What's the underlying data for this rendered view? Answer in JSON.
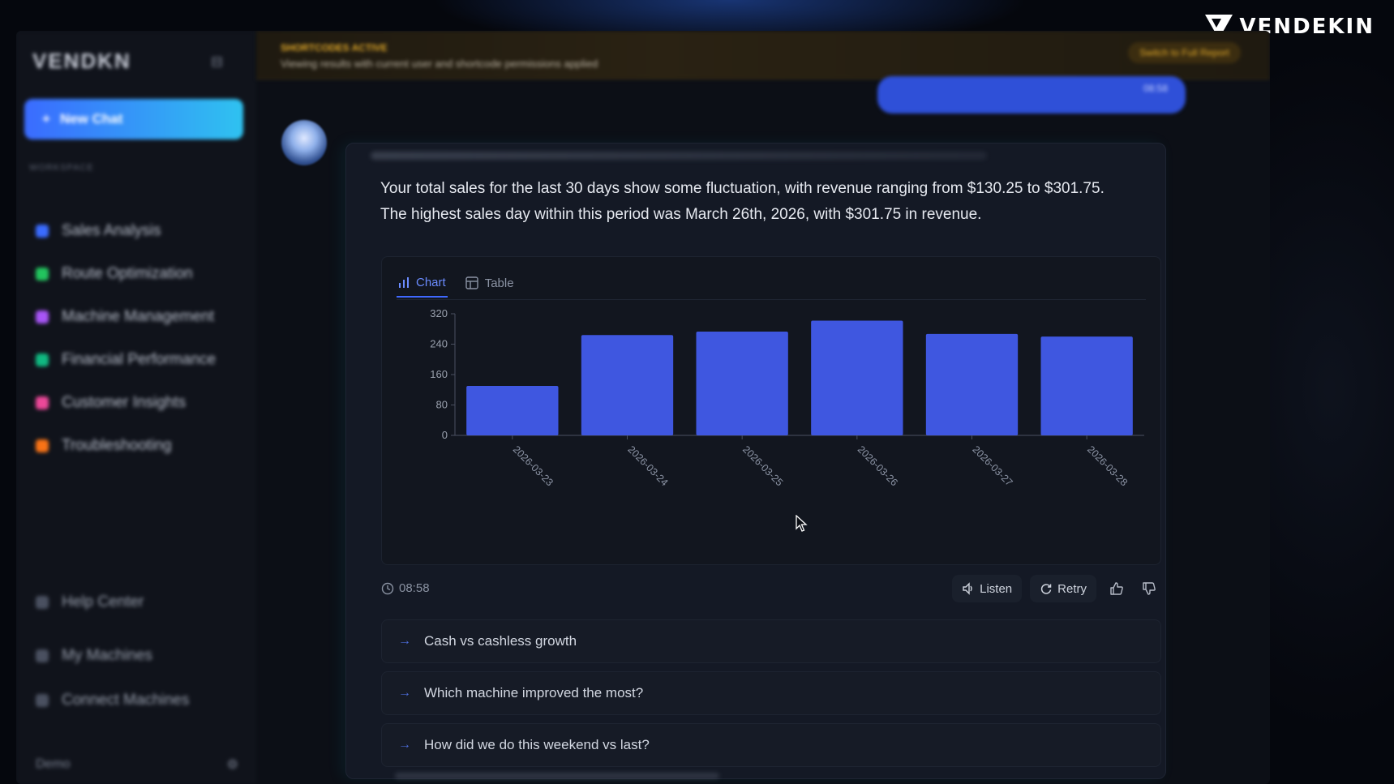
{
  "brand": {
    "name": "VENDEKIN"
  },
  "sidebar": {
    "logo": "VENDKN",
    "new_chat": "New Chat",
    "section_label": "WORKSPACE",
    "items": [
      {
        "label": "Sales Analysis",
        "color": "#3a6bff"
      },
      {
        "label": "Route Optimization",
        "color": "#22c55e"
      },
      {
        "label": "Machine Management",
        "color": "#a855f7"
      },
      {
        "label": "Financial Performance",
        "color": "#10b981"
      },
      {
        "label": "Customer Insights",
        "color": "#ec4899"
      },
      {
        "label": "Troubleshooting",
        "color": "#f97316"
      }
    ],
    "footer": [
      {
        "label": "Help Center"
      },
      {
        "label": "My Machines"
      },
      {
        "label": "Connect Machines"
      }
    ],
    "user": "Demo"
  },
  "banner": {
    "title": "SHORTCODES ACTIVE",
    "text": "Viewing results with current user and shortcode permissions applied",
    "button": "Switch to Full Report"
  },
  "user_message": {
    "time": "08:58"
  },
  "assistant": {
    "message_line1": "Your total sales for the last 30 days show some fluctuation, with revenue ranging from $130.25 to $301.75.",
    "message_line2": "The highest sales day within this period was March 26th, 2026, with $301.75 in revenue.",
    "tabs": {
      "chart": "Chart",
      "table": "Table"
    },
    "timestamp": "08:58",
    "actions": {
      "listen": "Listen",
      "retry": "Retry"
    },
    "suggestions": [
      "Cash vs cashless growth",
      "Which machine improved the most?",
      "How did we do this weekend vs last?"
    ]
  },
  "chart_data": {
    "type": "bar",
    "categories": [
      "2026-03-23",
      "2026-03-24",
      "2026-03-25",
      "2026-03-26",
      "2026-03-27",
      "2026-03-28"
    ],
    "values": [
      130.25,
      264,
      273,
      301.75,
      267,
      260
    ],
    "title": "",
    "xlabel": "",
    "ylabel": "",
    "ylim": [
      0,
      320
    ],
    "yticks": [
      0,
      80,
      160,
      240,
      320
    ],
    "grid": false,
    "bar_color": "#3f57e0"
  }
}
